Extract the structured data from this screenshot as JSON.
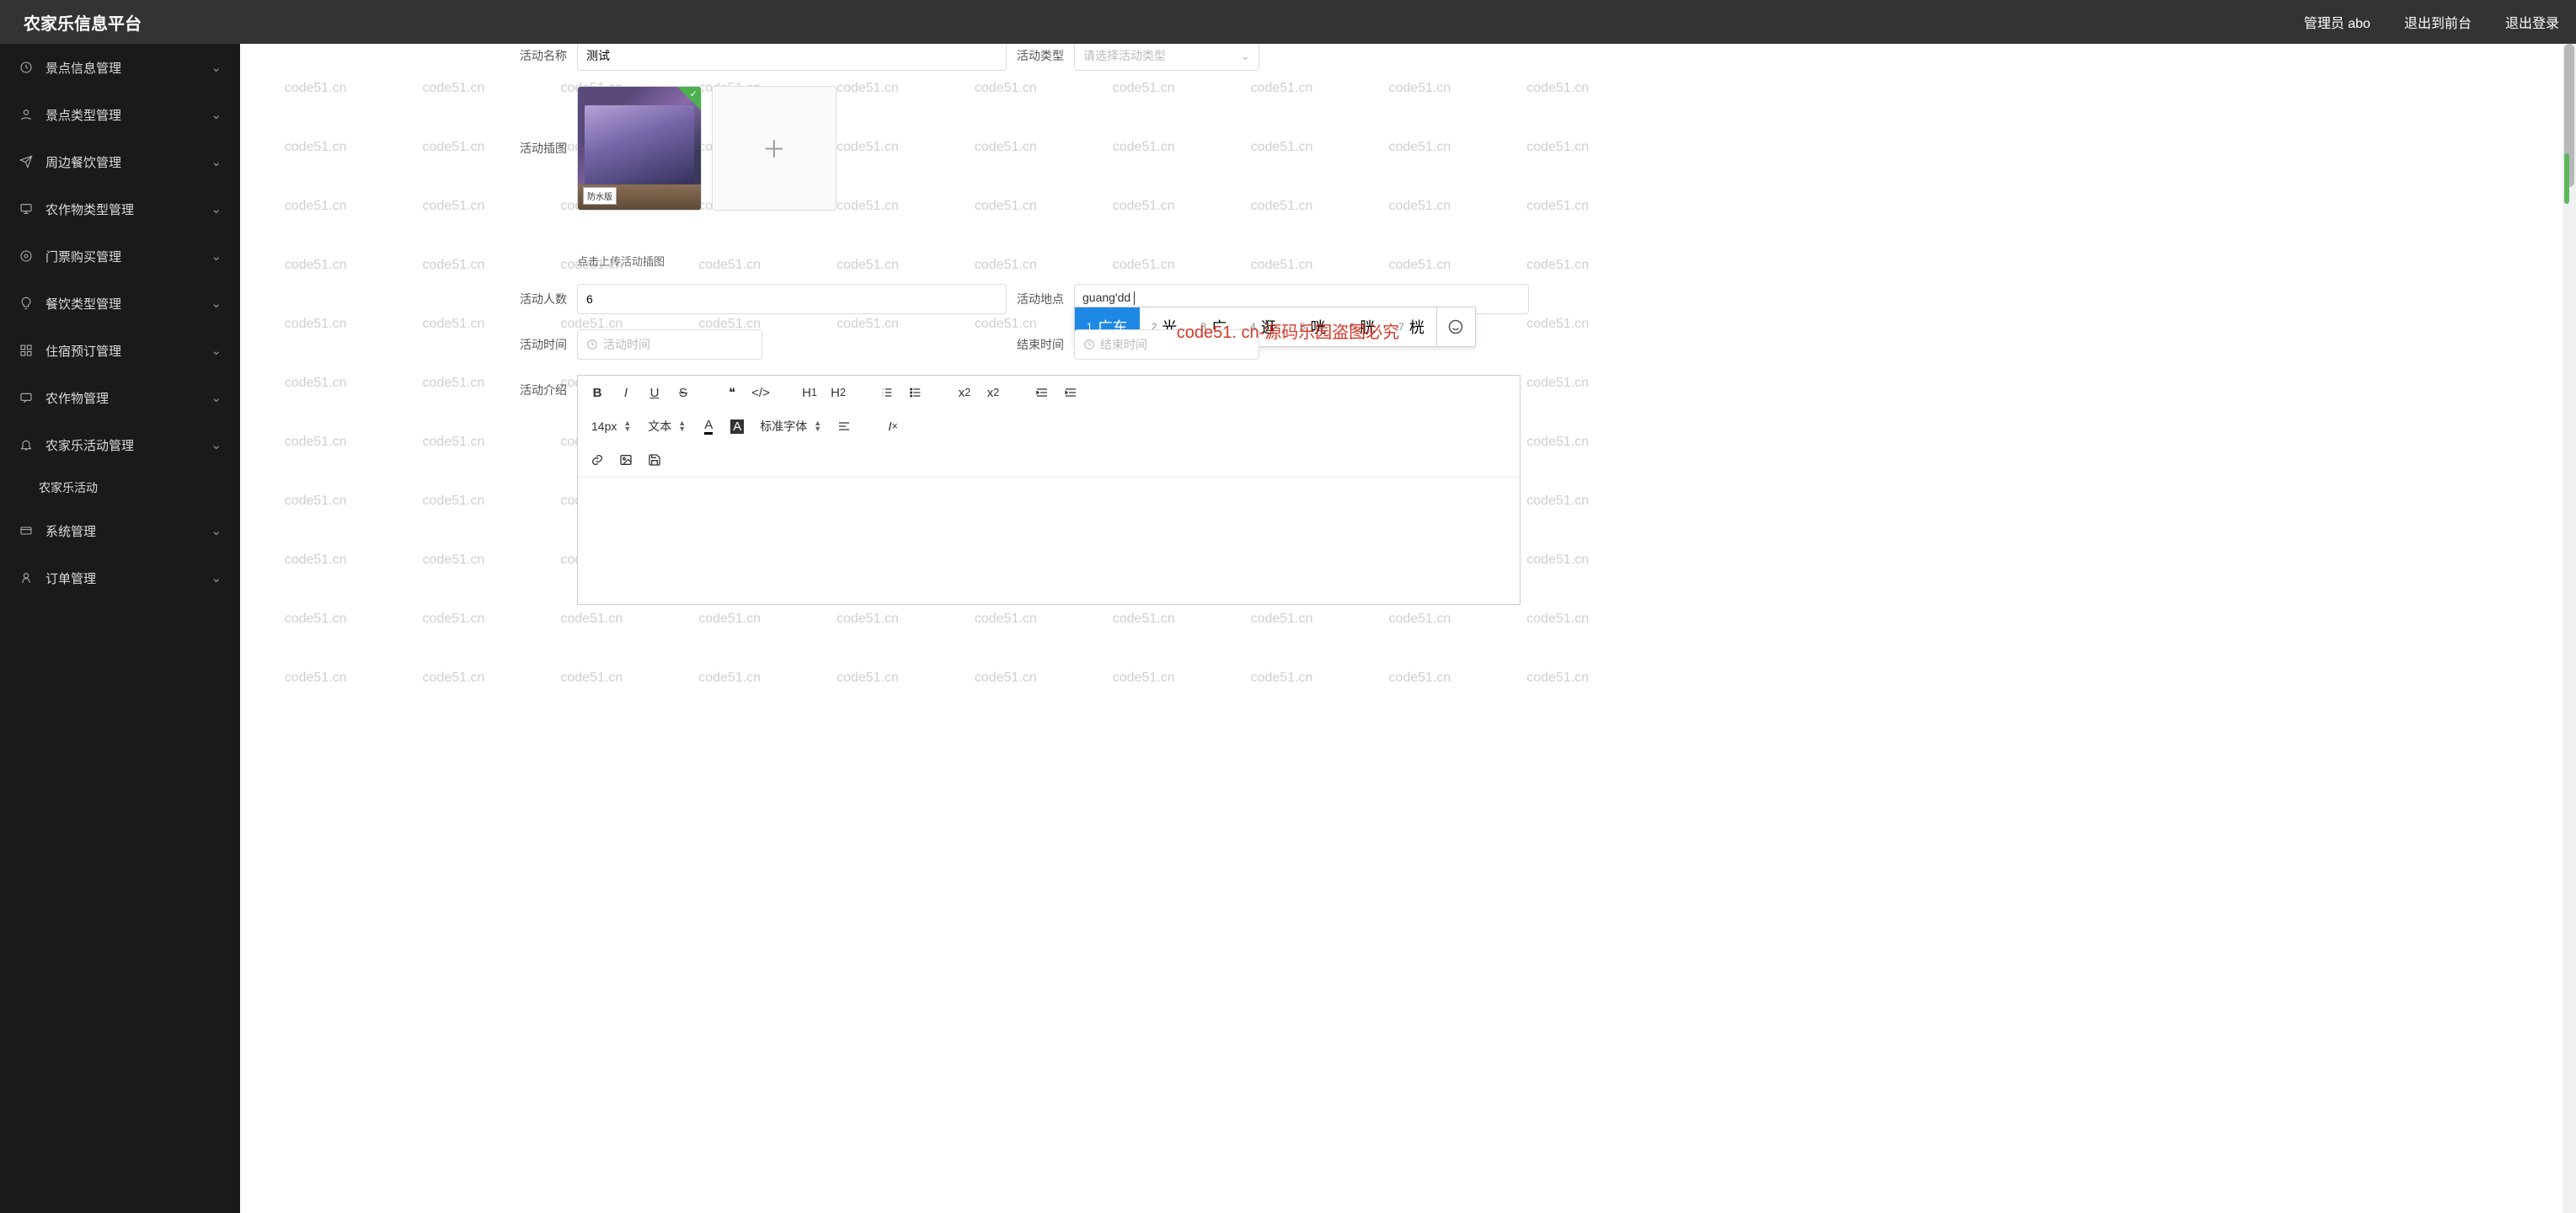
{
  "watermark_text": "code51.cn",
  "center_watermark": "code51. cn-源码乐园盗图必究",
  "header": {
    "brand": "农家乐信息平台",
    "admin": "管理员 abo",
    "to_front": "退出到前台",
    "logout": "退出登录"
  },
  "sidebar": {
    "items": [
      {
        "icon": "clock",
        "label": "景点信息管理"
      },
      {
        "icon": "user",
        "label": "景点类型管理"
      },
      {
        "icon": "send",
        "label": "周边餐饮管理"
      },
      {
        "icon": "monitor",
        "label": "农作物类型管理"
      },
      {
        "icon": "target",
        "label": "门票购买管理"
      },
      {
        "icon": "bulb",
        "label": "餐饮类型管理"
      },
      {
        "icon": "grid",
        "label": "住宿预订管理"
      },
      {
        "icon": "chat",
        "label": "农作物管理"
      },
      {
        "icon": "bell",
        "label": "农家乐活动管理"
      },
      {
        "icon": "",
        "label": "农家乐活动",
        "sub": true
      },
      {
        "icon": "card",
        "label": "系统管理"
      },
      {
        "icon": "person",
        "label": "订单管理"
      }
    ]
  },
  "form": {
    "name_label": "活动名称",
    "name_value": "测试",
    "type_label": "活动类型",
    "type_placeholder": "请选择活动类型",
    "img_label": "活动插图",
    "img_helper": "点击上传活动插图",
    "img_tag": "防水版",
    "people_label": "活动人数",
    "people_value": "6",
    "place_label": "活动地点",
    "time_label": "活动时间",
    "time_placeholder": "活动时间",
    "end_label": "结束时间",
    "end_placeholder": "结束时间",
    "intro_label": "活动介绍"
  },
  "ime": {
    "input": "guang'dd",
    "candidates": [
      {
        "n": "1",
        "ch": "广东"
      },
      {
        "n": "2",
        "ch": "光"
      },
      {
        "n": "3",
        "ch": "广"
      },
      {
        "n": "4",
        "ch": "逛"
      },
      {
        "n": "5",
        "ch": "咣"
      },
      {
        "n": "6",
        "ch": "胱"
      },
      {
        "n": "7",
        "ch": "桄"
      }
    ]
  },
  "editor": {
    "font_size": "14px",
    "font_style": "文本",
    "font_family": "标准字体"
  }
}
